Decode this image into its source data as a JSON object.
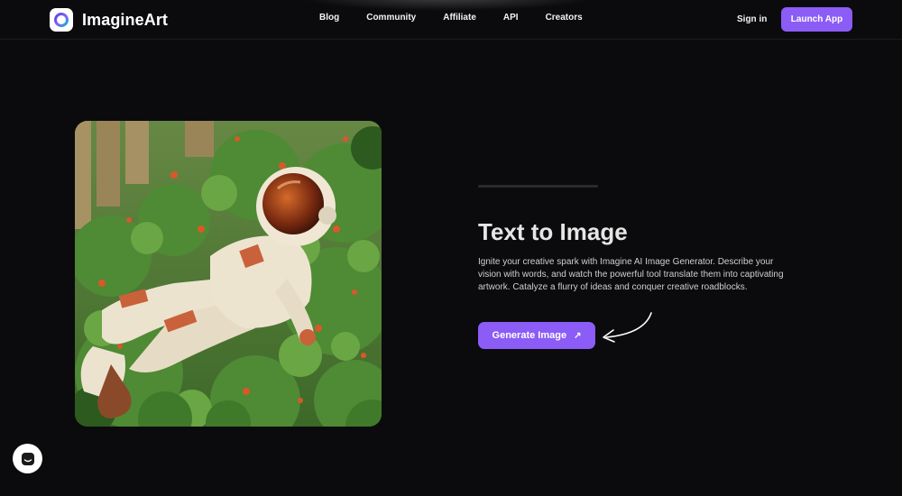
{
  "brand": {
    "name": "ImagineArt"
  },
  "nav": {
    "links": [
      "Blog",
      "Community",
      "Affiliate",
      "API",
      "Creators"
    ],
    "sign_in": "Sign in",
    "launch": "Launch App"
  },
  "hero": {
    "title": "Text to Image",
    "description": "Ignite your creative spark with Imagine AI Image Generator. Describe your vision with words, and watch the powerful tool translate them into captivating artwork. Catalyze a flurry of ideas and conquer creative roadblocks.",
    "cta_label": "Generate Image",
    "image_icon": "astronaut-illustration"
  },
  "colors": {
    "accent": "#8b5cf6",
    "background": "#0b0b0d"
  },
  "widgets": {
    "chat_icon": "chat-icon"
  }
}
